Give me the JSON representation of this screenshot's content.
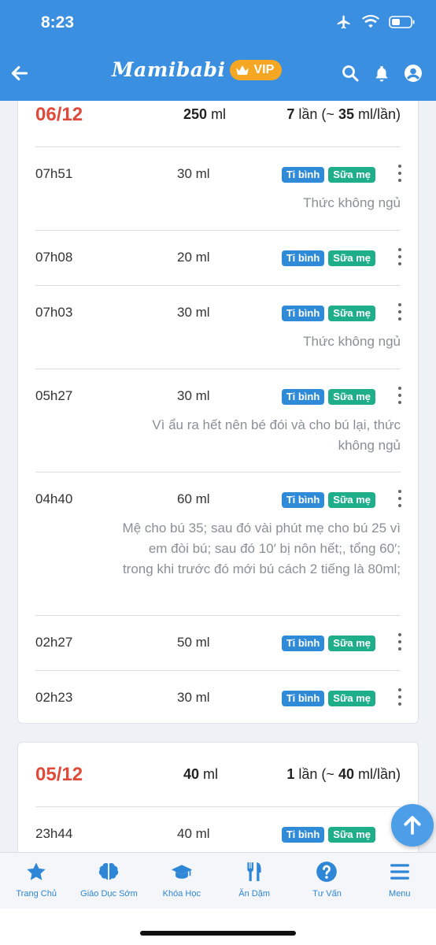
{
  "status": {
    "time": "8:23"
  },
  "header": {
    "brand": "Mamibabi",
    "vip": "VIP"
  },
  "colors": {
    "primary": "#3a8fe0",
    "date": "#e04a3a",
    "tag_bottle": "#2f8bd8",
    "tag_milk": "#1fae8a",
    "vip": "#f5a623"
  },
  "days": [
    {
      "date": "06/12",
      "total_value": "250",
      "total_unit": "ml",
      "count_value": "7",
      "count_text": "lần (~",
      "avg_value": "35",
      "avg_text": "ml/lần)",
      "entries": [
        {
          "time": "07h51",
          "volume": "30 ml",
          "tag1": "Ti bình",
          "tag2": "Sữa mẹ",
          "note": "Thức không ngủ"
        },
        {
          "time": "07h08",
          "volume": "20 ml",
          "tag1": "Ti bình",
          "tag2": "Sữa mẹ",
          "note": ""
        },
        {
          "time": "07h03",
          "volume": "30 ml",
          "tag1": "Ti bình",
          "tag2": "Sữa mẹ",
          "note": "Thức không ngủ"
        },
        {
          "time": "05h27",
          "volume": "30 ml",
          "tag1": "Ti bình",
          "tag2": "Sữa mẹ",
          "note": "Vì ẩu ra hết nên bé đói và cho bú lại, thức không ngủ"
        },
        {
          "time": "04h40",
          "volume": "60 ml",
          "tag1": "Ti bình",
          "tag2": "Sữa mẹ",
          "note": "Mệ cho bú 35; sau đó vài phút mẹ cho bú 25 vì em đòi bú; sau đó 10′ bị nôn hết;, tổng 60′; trong khi trước đó mới bú cách 2 tiếng là 80ml;"
        },
        {
          "time": "02h27",
          "volume": "50 ml",
          "tag1": "Ti bình",
          "tag2": "Sữa mẹ",
          "note": ""
        },
        {
          "time": "02h23",
          "volume": "30 ml",
          "tag1": "Ti bình",
          "tag2": "Sữa mẹ",
          "note": ""
        }
      ]
    },
    {
      "date": "05/12",
      "total_value": "40",
      "total_unit": "ml",
      "count_value": "1",
      "count_text": "lần (~",
      "avg_value": "40",
      "avg_text": "ml/lần)",
      "entries": [
        {
          "time": "23h44",
          "volume": "40 ml",
          "tag1": "Ti bình",
          "tag2": "Sữa mẹ",
          "note": ""
        }
      ]
    }
  ],
  "nav": [
    {
      "label": "Trang Chủ",
      "icon": "star-icon"
    },
    {
      "label": "Giáo Dục Sớm",
      "icon": "brain-icon"
    },
    {
      "label": "Khóa Học",
      "icon": "graduation-cap-icon"
    },
    {
      "label": "Ăn Dặm",
      "icon": "utensils-icon"
    },
    {
      "label": "Tư Vấn",
      "icon": "question-icon"
    },
    {
      "label": "Menu",
      "icon": "menu-icon"
    }
  ]
}
